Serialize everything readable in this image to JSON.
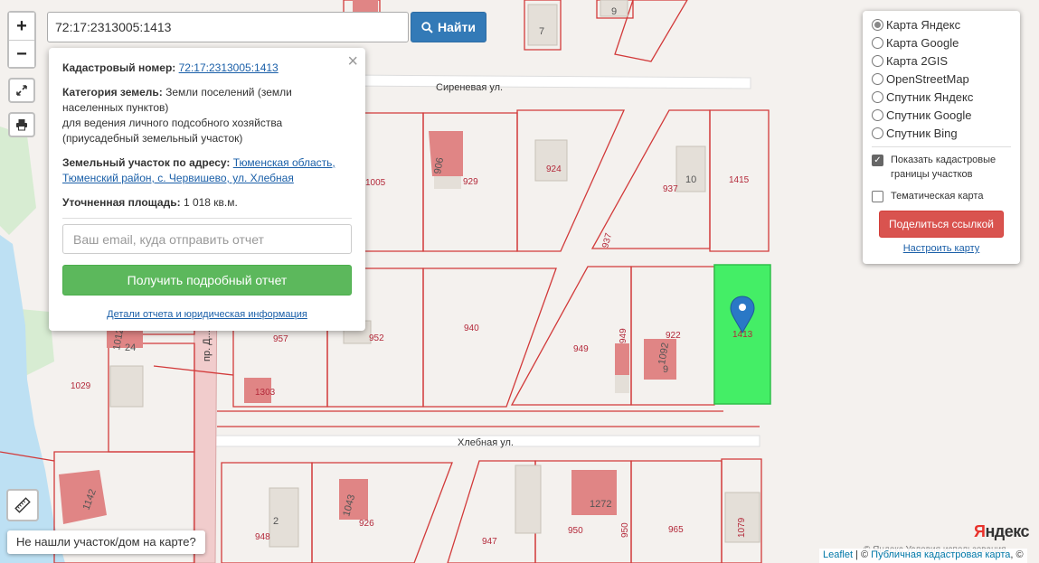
{
  "search": {
    "value": "72:17:2313005:1413",
    "button_label": "Найти"
  },
  "zoom": {
    "in_label": "+",
    "out_label": "−"
  },
  "popup": {
    "close_label": "×",
    "cadastral_label": "Кадастровый номер:",
    "cadastral_value": "72:17:2313005:1413",
    "category_label": "Категория земель:",
    "category_value_1": "Земли поселений (земли населенных пунктов)",
    "category_value_2": "для ведения личного подсобного хозяйства (приусадебный земельный участок)",
    "address_label": "Земельный участок по адресу:",
    "address_value": "Тюменская область, Тюменский район, с. Червишево, ул. Хлебная",
    "area_label": "Уточненная площадь:",
    "area_value": "1 018 кв.м.",
    "email_placeholder": "Ваш email, куда отправить отчет",
    "report_button": "Получить подробный отчет",
    "details_link": "Детали отчета и юридическая информация"
  },
  "layers": {
    "options": [
      {
        "label": "Карта Яндекс",
        "selected": true
      },
      {
        "label": "Карта Google",
        "selected": false
      },
      {
        "label": "Карта 2GIS",
        "selected": false
      },
      {
        "label": "OpenStreetMap",
        "selected": false
      },
      {
        "label": "Спутник Яндекс",
        "selected": false
      },
      {
        "label": "Спутник Google",
        "selected": false
      },
      {
        "label": "Спутник Bing",
        "selected": false
      }
    ],
    "show_cadastral_label": "Показать кадастровые границы участков",
    "show_cadastral_checked": true,
    "thematic_label": "Тематическая карта",
    "thematic_checked": false,
    "share_button": "Поделиться ссылкой",
    "configure_link": "Настроить карту"
  },
  "bottom": {
    "not_found_button": "Не нашли участок/дом на карте?",
    "yandex_y": "Я",
    "yandex_rest": "ндекс",
    "yandex_copy": "© Яндекс  Условия использования",
    "leaflet_link": "Leaflet",
    "attribution_sep": " | © ",
    "pkk_link": "Публичная кадастровая карта",
    "attribution_tail": ", ©"
  },
  "map": {
    "streets": {
      "sirenevaya": "Сиреневая ул.",
      "hlebnaya": "Хлебная ул.",
      "side": "пр. Д..."
    },
    "parcel_labels": [
      "1005",
      "929",
      "924",
      "937",
      "1415",
      "937",
      "957",
      "952",
      "940",
      "949",
      "922",
      "1413",
      "1029",
      "1303",
      "948",
      "926",
      "947",
      "950",
      "950",
      "965",
      "1079"
    ],
    "building_labels": [
      "7",
      "9",
      "10",
      "9",
      "2",
      "906",
      "1092",
      "1043",
      "1272",
      "1142",
      "1012",
      "949",
      "24"
    ],
    "colors": {
      "parcel_border": "#d23a3a",
      "building": "#e08585",
      "building_gray": "#e4dfd8",
      "selected_parcel": "#44ee66",
      "marker": "#2a78c6",
      "road": "#ffffff"
    }
  }
}
